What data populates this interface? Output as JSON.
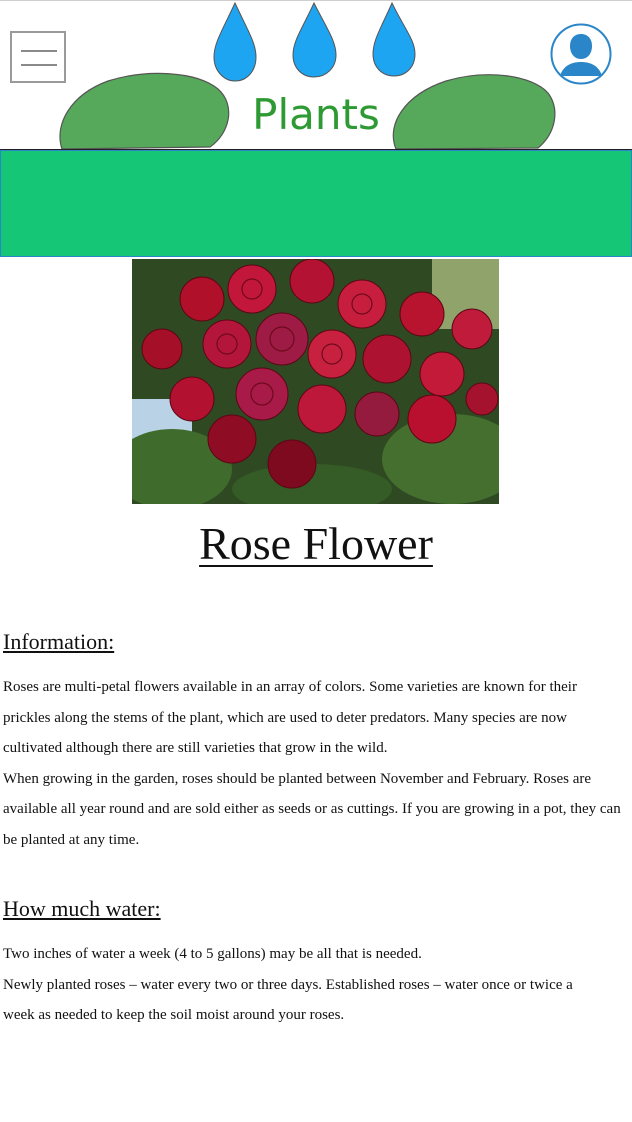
{
  "header": {
    "title": "Plants",
    "menu_icon": "hamburger-menu-icon",
    "profile_icon": "user-profile-icon",
    "colors": {
      "title": "#2d9a33",
      "drops": "#1ea5f2",
      "leaves": "#56a85a",
      "nav": "#15c676",
      "profile": "#2a86c9"
    }
  },
  "hero": {
    "image_subject": "red roses photo"
  },
  "page": {
    "title": "Rose Flower"
  },
  "information": {
    "heading": "Information:",
    "lines": [
      "Roses are multi-petal flowers available in an array of colors. Some varieties are known for their",
      "prickles along the stems of the plant, which are used to deter predators. Many species are now",
      "cultivated although there are still varieties that grow in the wild.",
      "When growing in the garden, roses should be planted between November and February. Roses are",
      "available all year round and are sold either as seeds or as cuttings. If you are growing in a pot, they can",
      "be planted at any time."
    ]
  },
  "water": {
    "heading": "How much water:",
    "lines": [
      "Two inches of water a week (4 to 5 gallons) may be all that is needed.",
      "Newly planted roses – water every two or three days. Established roses – water once or twice a",
      "week as needed to keep the soil moist around your roses."
    ]
  }
}
